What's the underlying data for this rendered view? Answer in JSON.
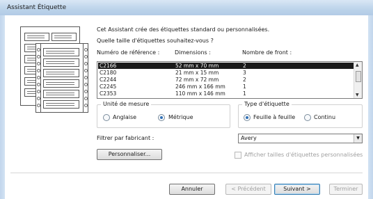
{
  "window": {
    "title": "Assistant Étiquette"
  },
  "intro": {
    "line1": "Cet Assistant crée des étiquettes standard ou personnalisées.",
    "question": "Quelle taille d'étiquettes souhaitez-vous ?"
  },
  "list": {
    "headers": [
      "Numéro de référence :",
      "Dimensions :",
      "Nombre de front :"
    ],
    "rows": [
      {
        "ref": "C2166",
        "dim": "52 mm x 70 mm",
        "front": "2",
        "selected": true
      },
      {
        "ref": "C2180",
        "dim": "21 mm x 15 mm",
        "front": "3",
        "selected": false
      },
      {
        "ref": "C2244",
        "dim": "72 mm x 72 mm",
        "front": "2",
        "selected": false
      },
      {
        "ref": "C2245",
        "dim": "246 mm x 166 mm",
        "front": "1",
        "selected": false
      },
      {
        "ref": "C2353",
        "dim": "110 mm x 146 mm",
        "front": "1",
        "selected": false
      }
    ]
  },
  "units": {
    "title": "Unité de mesure",
    "options": [
      "Anglaise",
      "Métrique"
    ],
    "selected": "Métrique"
  },
  "label_type": {
    "title": "Type d'étiquette",
    "options": [
      "Feuille à feuille",
      "Continu"
    ],
    "selected": "Feuille à feuille"
  },
  "filter": {
    "label": "Filtrer par fabricant :",
    "value": "Avery"
  },
  "customize": {
    "button": "Personnaliser...",
    "checkbox_label": "Afficher tailles d'étiquettes personnalisées"
  },
  "footer": {
    "cancel": "Annuler",
    "previous": "< Précédent",
    "next": "Suivant >",
    "finish": "Terminer"
  }
}
